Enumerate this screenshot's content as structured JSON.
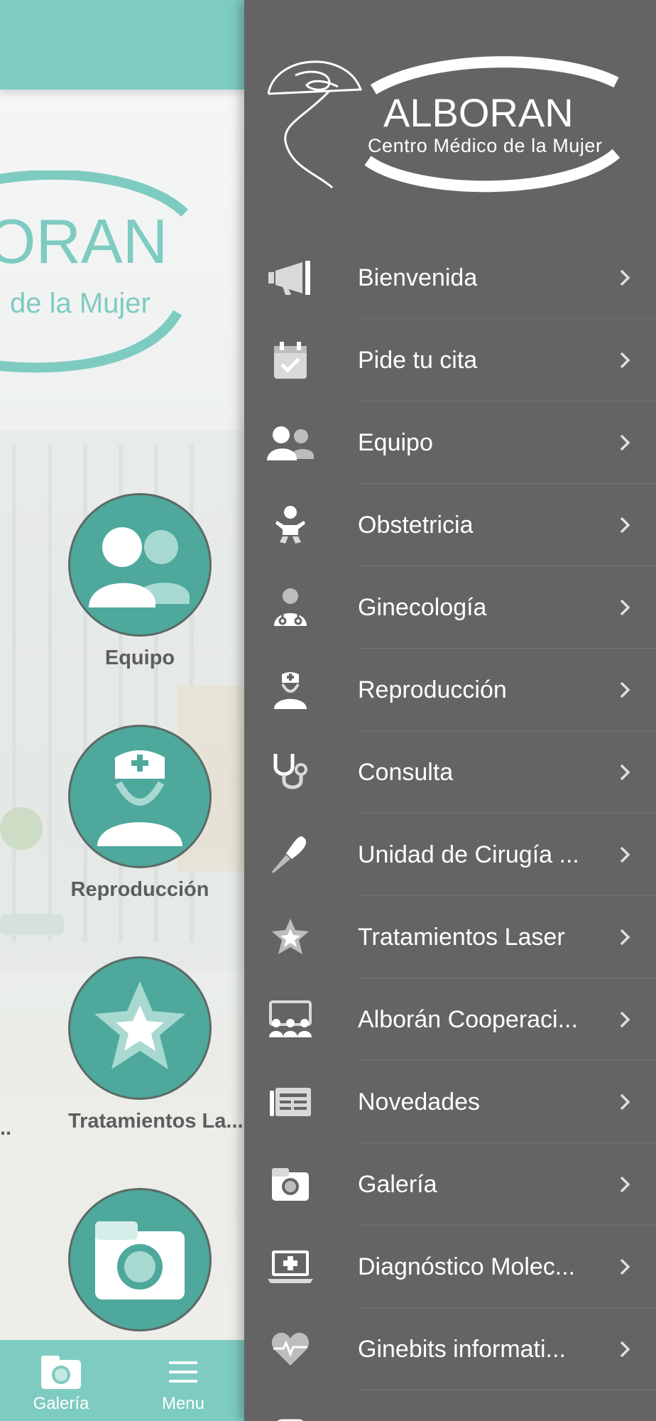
{
  "app": {
    "logo": {
      "name": "ALBORAN",
      "tagline": "Centro Médico de la Mujer"
    }
  },
  "background": {
    "logo_fragment": {
      "name_partial": "ORAN",
      "tagline_partial": "de la Mujer"
    },
    "cards": [
      {
        "label": "Equipo",
        "icon": "team-icon"
      },
      {
        "label": "Reproducción",
        "icon": "nurse-icon"
      },
      {
        "label": "Tratamientos La...",
        "icon": "star-badge-icon"
      },
      {
        "label": "",
        "icon": "camera-icon"
      }
    ],
    "left_fragment": "..",
    "tabbar": {
      "gallery": {
        "label": "Galería",
        "icon": "camera-icon"
      },
      "menu": {
        "label": "Menu",
        "icon": "hamburger-icon"
      }
    }
  },
  "drawer": {
    "items": [
      {
        "label": "Bienvenida",
        "icon": "megaphone-icon"
      },
      {
        "label": "Pide tu cita",
        "icon": "calendar-check-icon"
      },
      {
        "label": "Equipo",
        "icon": "users-icon"
      },
      {
        "label": "Obstetricia",
        "icon": "baby-icon"
      },
      {
        "label": "Ginecología",
        "icon": "doctor-stethoscope-icon"
      },
      {
        "label": "Reproducción",
        "icon": "nurse-icon"
      },
      {
        "label": "Consulta",
        "icon": "stethoscope-icon"
      },
      {
        "label": "Unidad de Cirugía ...",
        "icon": "scalpel-icon"
      },
      {
        "label": "Tratamientos Laser",
        "icon": "star-badge-icon"
      },
      {
        "label": "Alborán Cooperaci...",
        "icon": "community-icon"
      },
      {
        "label": "Novedades",
        "icon": "newspaper-icon"
      },
      {
        "label": "Galería",
        "icon": "camera-icon"
      },
      {
        "label": "Diagnóstico Molec...",
        "icon": "laptop-medical-icon"
      },
      {
        "label": "Ginebits informati...",
        "icon": "heart-pulse-icon"
      }
    ]
  },
  "colors": {
    "accent": "#7ecbc1",
    "card": "#4ea89c",
    "drawer_bg": "#646464",
    "drawer_text": "#ffffff",
    "drawer_icon": "#d9d9d9"
  }
}
